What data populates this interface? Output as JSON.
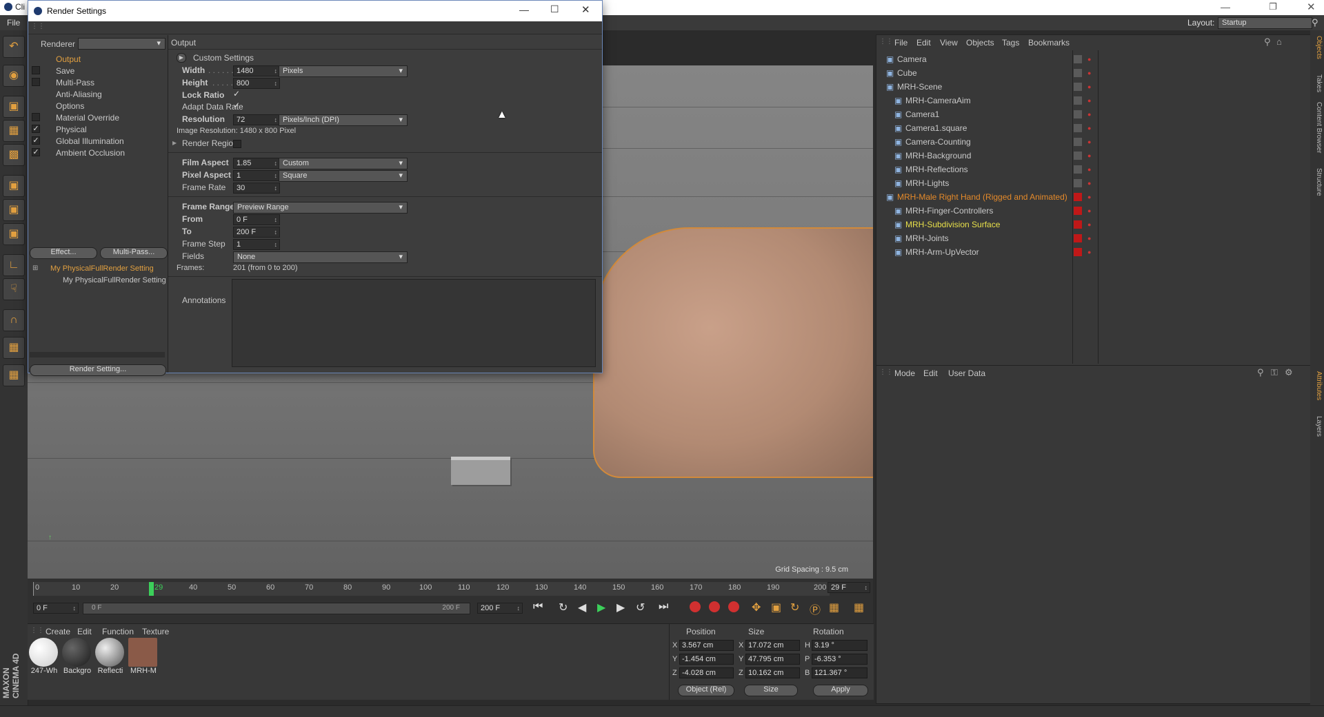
{
  "app": {
    "title_prefix": "Cli",
    "menu_file": "File",
    "layout_label": "Layout:",
    "layout_value": "Startup",
    "brand": "MAXON CINEMA 4D"
  },
  "dialog": {
    "title": "Render Settings",
    "renderer_label": "Renderer",
    "renderer_value": "",
    "nav": [
      {
        "label": "Output",
        "checked": null,
        "active": true
      },
      {
        "label": "Save",
        "checked": false
      },
      {
        "label": "Multi-Pass",
        "checked": false
      },
      {
        "label": "Anti-Aliasing",
        "checked": null
      },
      {
        "label": "Options",
        "checked": null
      },
      {
        "label": "Material Override",
        "checked": false
      },
      {
        "label": "Physical",
        "checked": true
      },
      {
        "label": "Global Illumination",
        "checked": true
      },
      {
        "label": "Ambient Occlusion",
        "checked": true
      }
    ],
    "effect_button": "Effect...",
    "multipass_button": "Multi-Pass...",
    "preset_parent": "My PhysicalFullRender Setting",
    "preset_child": "My PhysicalFullRender Setting",
    "render_setting_button": "Render Setting...",
    "section_title": "Output",
    "custom_settings": "Custom Settings",
    "width_label": "Width",
    "width_value": "1480",
    "width_unit": "Pixels",
    "height_label": "Height",
    "height_value": "800",
    "lock_ratio_label": "Lock Ratio",
    "adapt_rate_label": "Adapt Data Rate",
    "resolution_label": "Resolution",
    "resolution_value": "72",
    "resolution_unit": "Pixels/Inch (DPI)",
    "image_resolution": "Image Resolution: 1480 x 800 Pixel",
    "render_region_label": "Render Region",
    "film_aspect_label": "Film Aspect",
    "film_aspect_value": "1.85",
    "film_aspect_preset": "Custom",
    "pixel_aspect_label": "Pixel Aspect",
    "pixel_aspect_value": "1",
    "pixel_aspect_preset": "Square",
    "frame_rate_label": "Frame Rate",
    "frame_rate_value": "30",
    "frame_range_label": "Frame Range",
    "frame_range_value": "Preview Range",
    "from_label": "From",
    "from_value": "0 F",
    "to_label": "To",
    "to_value": "200 F",
    "frame_step_label": "Frame Step",
    "frame_step_value": "1",
    "fields_label": "Fields",
    "fields_value": "None",
    "frames_text": "Frames:",
    "frames_value": "201 (from 0 to 200)",
    "annotations_label": "Annotations"
  },
  "viewport": {
    "grid_spacing": "Grid Spacing : 9.5 cm"
  },
  "timeline": {
    "ticks": [
      "0",
      "10",
      "20",
      "29",
      "40",
      "50",
      "60",
      "70",
      "80",
      "90",
      "100",
      "110",
      "120",
      "130",
      "140",
      "150",
      "160",
      "170",
      "180",
      "190",
      "200"
    ],
    "current_frame": "29 F",
    "start_field": "0 F",
    "range_start": "0 F",
    "range_end": "200 F",
    "end_field": "200 F"
  },
  "materials": {
    "menu": [
      "Create",
      "Edit",
      "Function",
      "Texture"
    ],
    "items": [
      {
        "label": "247-Wh",
        "color": "#f2f2f2"
      },
      {
        "label": "Backgro",
        "color": "#3a3a3a"
      },
      {
        "label": "Reflecti",
        "color": "#9a9a9a"
      },
      {
        "label": "MRH-M",
        "color": "#8a5a48"
      }
    ]
  },
  "coords": {
    "headers": [
      "Position",
      "Size",
      "Rotation"
    ],
    "pos": [
      "3.567 cm",
      "-1.454 cm",
      "-4.028 cm"
    ],
    "size": [
      "17.072 cm",
      "47.795 cm",
      "10.162 cm"
    ],
    "rot": [
      "3.19 °",
      "-6.353 °",
      "121.367 °"
    ],
    "axes_pos": [
      "X",
      "Y",
      "Z"
    ],
    "axes_size": [
      "X",
      "Y",
      "Z"
    ],
    "axes_rot": [
      "H",
      "P",
      "B"
    ],
    "mode": "Object (Rel)",
    "size_mode": "Size",
    "apply": "Apply"
  },
  "object_manager": {
    "menu": [
      "File",
      "Edit",
      "View",
      "Objects",
      "Tags",
      "Bookmarks"
    ],
    "objects": [
      {
        "name": "Camera",
        "indent": 0,
        "color": "#c9c9c9"
      },
      {
        "name": "Cube",
        "indent": 0,
        "color": "#c9c9c9"
      },
      {
        "name": "MRH-Scene",
        "indent": 0,
        "color": "#c9c9c9"
      },
      {
        "name": "MRH-CameraAim",
        "indent": 1,
        "color": "#c9c9c9"
      },
      {
        "name": "Camera1",
        "indent": 1,
        "color": "#c9c9c9"
      },
      {
        "name": "Camera1.square",
        "indent": 1,
        "color": "#c9c9c9"
      },
      {
        "name": "Camera-Counting",
        "indent": 1,
        "color": "#c9c9c9"
      },
      {
        "name": "MRH-Background",
        "indent": 1,
        "color": "#c9c9c9"
      },
      {
        "name": "MRH-Reflections",
        "indent": 1,
        "color": "#c9c9c9"
      },
      {
        "name": "MRH-Lights",
        "indent": 1,
        "color": "#c9c9c9"
      },
      {
        "name": "MRH-Male Right Hand (Rigged and Animated)",
        "indent": 0,
        "color": "#e58a2a"
      },
      {
        "name": "MRH-Finger-Controllers",
        "indent": 1,
        "color": "#c9c9c9"
      },
      {
        "name": "MRH-Subdivision Surface",
        "indent": 1,
        "color": "#e8e04a"
      },
      {
        "name": "MRH-Joints",
        "indent": 1,
        "color": "#c9c9c9"
      },
      {
        "name": "MRH-Arm-UpVector",
        "indent": 1,
        "color": "#c9c9c9"
      }
    ]
  },
  "attribute_manager": {
    "menu": [
      "Mode",
      "Edit",
      "User Data"
    ]
  },
  "right_tabs": [
    "Objects",
    "Takes",
    "Content Browser",
    "Structure",
    "Attributes",
    "Layers"
  ]
}
